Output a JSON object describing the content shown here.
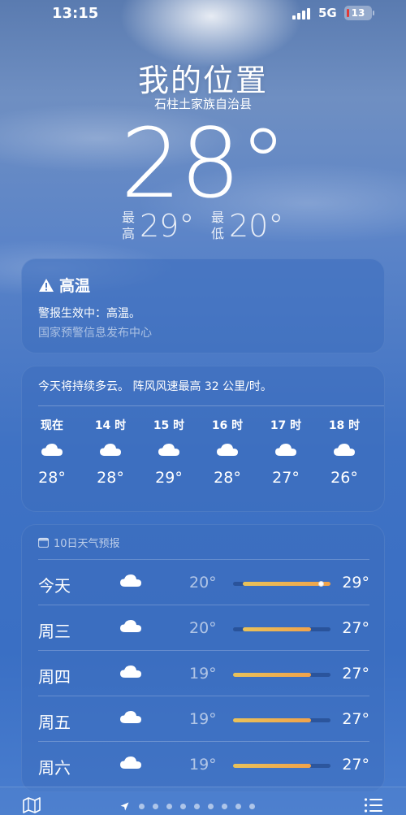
{
  "status_bar": {
    "time": "13:15",
    "network": "5G",
    "battery": "13",
    "battery_color": "#e03a3a"
  },
  "header": {
    "title": "我的位置",
    "subtitle": "石柱土家族自治县",
    "temperature": "28°",
    "high_label": "最高",
    "high_value": "29°",
    "low_label": "最低",
    "low_value": "20°"
  },
  "alert": {
    "icon": "warning-icon",
    "title": "高温",
    "text": "警报生效中：高温。",
    "source": "国家预警信息发布中心"
  },
  "hourly": {
    "summary": "今天将持续多云。 阵风风速最高 32 公里/时。",
    "items": [
      {
        "label": "现在",
        "icon": "cloud-icon",
        "temp": "28°"
      },
      {
        "label": "14 时",
        "icon": "cloud-icon",
        "temp": "28°"
      },
      {
        "label": "15 时",
        "icon": "cloud-icon",
        "temp": "29°"
      },
      {
        "label": "16 时",
        "icon": "cloud-icon",
        "temp": "28°"
      },
      {
        "label": "17 时",
        "icon": "cloud-icon",
        "temp": "27°"
      },
      {
        "label": "18 时",
        "icon": "cloud-icon",
        "temp": "26°"
      }
    ]
  },
  "daily": {
    "title": "10日天气预报",
    "range_min": 19,
    "range_max": 29,
    "items": [
      {
        "day": "今天",
        "icon": "cloud-icon",
        "low": "20°",
        "high": "29°",
        "low_value": 20,
        "high_value": 29,
        "current_value": 28
      },
      {
        "day": "周三",
        "icon": "cloud-icon",
        "low": "20°",
        "high": "27°",
        "low_value": 20,
        "high_value": 27
      },
      {
        "day": "周四",
        "icon": "cloud-icon",
        "low": "19°",
        "high": "27°",
        "low_value": 19,
        "high_value": 27
      },
      {
        "day": "周五",
        "icon": "cloud-icon",
        "low": "19°",
        "high": "27°",
        "low_value": 19,
        "high_value": 27
      },
      {
        "day": "周六",
        "icon": "cloud-icon",
        "low": "19°",
        "high": "27°",
        "low_value": 19,
        "high_value": 27
      }
    ]
  },
  "bottom_bar": {
    "left_icon": "map-icon",
    "right_icon": "list-icon",
    "page_count": 10,
    "current_page": 0
  }
}
